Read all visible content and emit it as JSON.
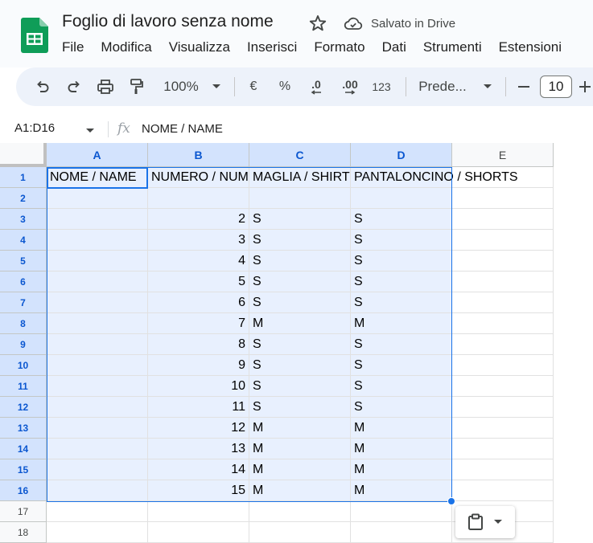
{
  "header": {
    "title": "Foglio di lavoro senza nome",
    "save_status": "Salvato in Drive"
  },
  "menu": [
    "File",
    "Modifica",
    "Visualizza",
    "Inserisci",
    "Formato",
    "Dati",
    "Strumenti",
    "Estensioni"
  ],
  "toolbar": {
    "zoom": "100%",
    "currency": "€",
    "percent": "%",
    "decrease_decimals": ".0",
    "increase_decimals": ".00",
    "number_format": "123",
    "font": "Prede...",
    "font_size": "10"
  },
  "formula_bar": {
    "name_box": "A1:D16",
    "fx": "fx",
    "value": "NOME / NAME"
  },
  "columns": [
    "A",
    "B",
    "C",
    "D",
    "E"
  ],
  "rows": [
    "1",
    "2",
    "3",
    "4",
    "5",
    "6",
    "7",
    "8",
    "9",
    "10",
    "11",
    "12",
    "13",
    "14",
    "15",
    "16",
    "17",
    "18"
  ],
  "cells": [
    [
      "NOME / NAME",
      "NUMERO / NUMBER",
      "MAGLIA /  SHIRT",
      "PANTALONCINO / SHORTS"
    ],
    [
      "",
      "",
      "",
      ""
    ],
    [
      "",
      "2",
      "S",
      "S"
    ],
    [
      "",
      "3",
      "S",
      "S"
    ],
    [
      "",
      "4",
      "S",
      "S"
    ],
    [
      "",
      "5",
      "S",
      "S"
    ],
    [
      "",
      "6",
      "S",
      "S"
    ],
    [
      "",
      "7",
      "M",
      "M"
    ],
    [
      "",
      "8",
      "S",
      "S"
    ],
    [
      "",
      "9",
      "S",
      "S"
    ],
    [
      "",
      "10",
      "S",
      "S"
    ],
    [
      "",
      "11",
      "S",
      "S"
    ],
    [
      "",
      "12",
      "M",
      "M"
    ],
    [
      "",
      "13",
      "M",
      "M"
    ],
    [
      "",
      "14",
      "M",
      "M"
    ],
    [
      "",
      "15",
      "M",
      "M"
    ]
  ],
  "colors": {
    "accent": "#1a73e8",
    "selection_fill": "#e8f0fe",
    "selected_header": "#d3e3fd",
    "logo_green": "#0f9d58"
  },
  "icons": {
    "logo": "google-sheets-logo",
    "star": "star-icon",
    "cloud": "cloud-done-icon",
    "undo": "undo-icon",
    "redo": "redo-icon",
    "print": "print-icon",
    "paint_format": "paint-format-icon",
    "paste": "clipboard-icon"
  }
}
